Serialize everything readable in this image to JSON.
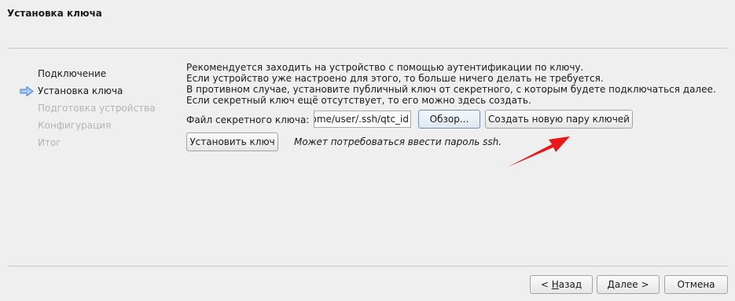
{
  "window": {
    "title": "Установка ключа"
  },
  "steps": [
    {
      "label": "Подключение",
      "state": "done"
    },
    {
      "label": "Установка ключа",
      "state": "current"
    },
    {
      "label": "Подготовка устройства",
      "state": "future"
    },
    {
      "label": "Конфигурация",
      "state": "future"
    },
    {
      "label": "Итог",
      "state": "future"
    }
  ],
  "description": [
    "Рекомендуется заходить на устройство с помощью аутентификации по ключу.",
    "Если устройство уже настроено для этого, то больше ничего делать не требуется.",
    "В противном случае, установите публичный ключ от секретного, с которым будете подключаться далее.",
    "Если секретный ключ ещё отсутствует, то его можно здесь создать."
  ],
  "key_file": {
    "label": "Файл секретного ключа:",
    "value": "/home/user/.ssh/qtc_id",
    "browse_label": "Обзор...",
    "create_pair_label": "Создать новую пару ключей"
  },
  "install": {
    "button_label": "Установить ключ",
    "note": "Может потребоваться ввести пароль ssh."
  },
  "footer": {
    "back_prefix": "< ",
    "back_mnemonic": "Н",
    "back_rest": "азад",
    "next_mnemonic": "Д",
    "next_rest": "алее >",
    "cancel_label": "Отмена"
  },
  "colors": {
    "annotation_arrow": "#e81818",
    "step_arrow": "#4a7fd0",
    "disabled_text": "#b4b4b4"
  }
}
